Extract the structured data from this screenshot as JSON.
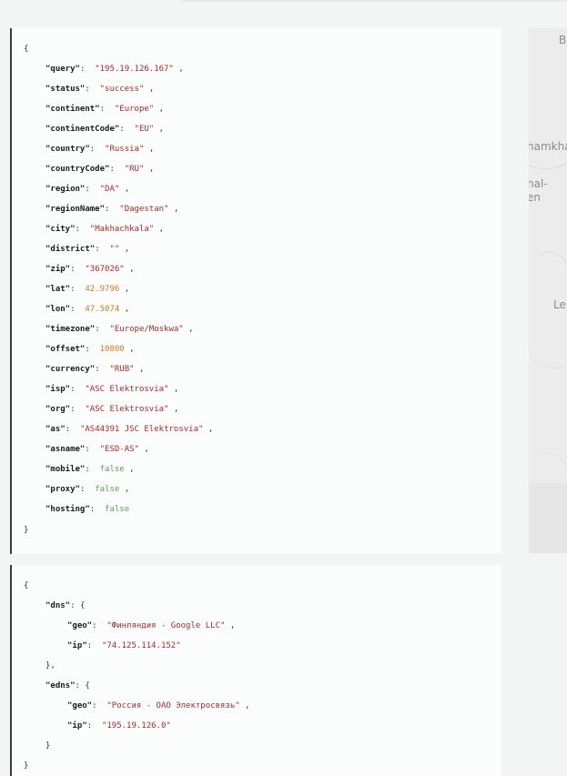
{
  "json_block_1": {
    "open": "{",
    "close": "}",
    "entries": [
      {
        "key": "\"query\"",
        "value": "\"195.19.126.167\"",
        "type": "str",
        "comma": " ,"
      },
      {
        "key": "\"status\"",
        "value": "\"success\"",
        "type": "str",
        "comma": " ,"
      },
      {
        "key": "\"continent\"",
        "value": "\"Europe\"",
        "type": "str",
        "comma": " ,"
      },
      {
        "key": "\"continentCode\"",
        "value": "\"EU\"",
        "type": "str",
        "comma": " ,"
      },
      {
        "key": "\"country\"",
        "value": "\"Russia\"",
        "type": "str",
        "comma": " ,"
      },
      {
        "key": "\"countryCode\"",
        "value": "\"RU\"",
        "type": "str",
        "comma": " ,"
      },
      {
        "key": "\"region\"",
        "value": "\"DA\"",
        "type": "str",
        "comma": " ,"
      },
      {
        "key": "\"regionName\"",
        "value": "\"Dagestan\"",
        "type": "str",
        "comma": " ,"
      },
      {
        "key": "\"city\"",
        "value": "\"Makhachkala\"",
        "type": "str",
        "comma": " ,"
      },
      {
        "key": "\"district\"",
        "value": "\"\"",
        "type": "str",
        "comma": " ,"
      },
      {
        "key": "\"zip\"",
        "value": "\"367026\"",
        "type": "str",
        "comma": " ,"
      },
      {
        "key": "\"lat\"",
        "value": "42.9796",
        "type": "num",
        "comma": " ,"
      },
      {
        "key": "\"lon\"",
        "value": "47.5074",
        "type": "num",
        "comma": " ,"
      },
      {
        "key": "\"timezone\"",
        "value": "\"Europe/Moskwa\"",
        "type": "str",
        "comma": " ,"
      },
      {
        "key": "\"offset\"",
        "value": "10800",
        "type": "num",
        "comma": " ,"
      },
      {
        "key": "\"currency\"",
        "value": "\"RUB\"",
        "type": "str",
        "comma": " ,"
      },
      {
        "key": "\"isp\"",
        "value": "\"ASC Elektrosvia\"",
        "type": "str",
        "comma": " ,"
      },
      {
        "key": "\"org\"",
        "value": "\"ASC Elektrosvia\"",
        "type": "str",
        "comma": " ,"
      },
      {
        "key": "\"as\"",
        "value": "\"AS44391 JSC Elektrosvia\"",
        "type": "str",
        "comma": " ,"
      },
      {
        "key": "\"asname\"",
        "value": "\"ESD-AS\"",
        "type": "str",
        "comma": " ,"
      },
      {
        "key": "\"mobile\"",
        "value": "false",
        "type": "bool",
        "comma": " ,"
      },
      {
        "key": "\"proxy\"",
        "value": "false",
        "type": "bool",
        "comma": " ,"
      },
      {
        "key": "\"hosting\"",
        "value": "false",
        "type": "bool",
        "comma": ""
      }
    ]
  },
  "json_block_2": {
    "open": "{",
    "close": "}",
    "dns": {
      "key": "\"dns\"",
      "open": "{",
      "close": "},",
      "geo_key": "\"geo\"",
      "geo_value": "\"Финляндия - Google LLC\"",
      "ip_key": "\"ip\"",
      "ip_value": "\"74.125.114.152\""
    },
    "edns": {
      "key": "\"edns\"",
      "open": "{",
      "close": "}",
      "geo_key": "\"geo\"",
      "geo_value": "\"Россия - ОАО Электросвязь\"",
      "ip_key": "\"ip\"",
      "ip_value": "\"195.19.126.0\""
    }
  },
  "map": {
    "labels": [
      "B",
      "hamkha",
      "hal-",
      "en",
      "Le"
    ]
  }
}
